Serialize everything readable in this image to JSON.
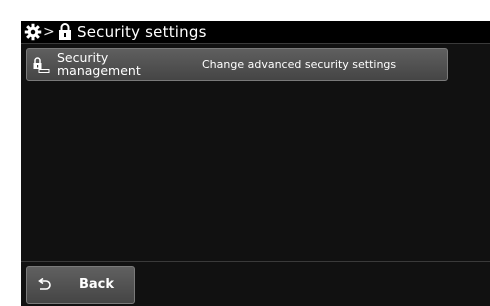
{
  "header": {
    "gear_icon": "gear-icon",
    "separator": ">",
    "lock_icon": "lock-icon",
    "title": "Security settings"
  },
  "menu": {
    "items": [
      {
        "icon": "lock-key-icon",
        "label_line1": "Security",
        "label_line2": "management",
        "description": "Change advanced security settings"
      }
    ]
  },
  "footer": {
    "back_icon": "return-arrow-icon",
    "back_label": "Back"
  },
  "colors": {
    "screen_bg": "#111111",
    "header_bg": "#000000",
    "button_gradient_top": "#606060",
    "button_gradient_bottom": "#454545",
    "text": "#ffffff"
  }
}
